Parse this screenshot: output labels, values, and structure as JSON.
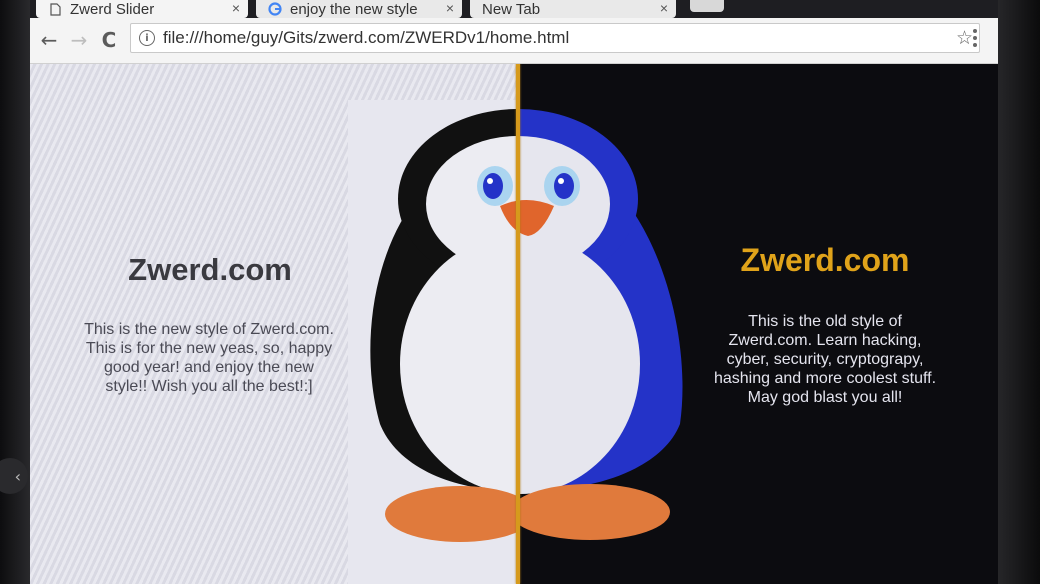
{
  "tabs": [
    {
      "title": "Zwerd Slider",
      "close": "×"
    },
    {
      "title": "enjoy the new style",
      "close": "×"
    },
    {
      "title": "New Tab",
      "close": "×"
    }
  ],
  "toolbar": {
    "back": "←",
    "forward": "→",
    "reload": "C",
    "info": "i",
    "url": "file:///home/guy/Gits/zwerd.com/ZWERDv1/home.html",
    "star": "☆"
  },
  "new_style": {
    "title": "Zwerd.com",
    "text": "This is the new style of Zwerd.com. This is for the new yeas, so, happy good year! and enjoy the new style!! Wish you all the best!:]"
  },
  "old_style": {
    "title": "Zwerd.com",
    "text": "This is the old style of Zwerd.com. Learn hacking, cyber, security, cryptograpy, hashing and more coolest stuff. May god blast you all!"
  },
  "colors": {
    "divider": "#d69a1c",
    "old_title": "#e0a31a",
    "penguin_left_body": "#111111",
    "penguin_right_body": "#2433c8",
    "feet": "#e07a3c"
  },
  "side_nav": {
    "arrow": "‹"
  }
}
